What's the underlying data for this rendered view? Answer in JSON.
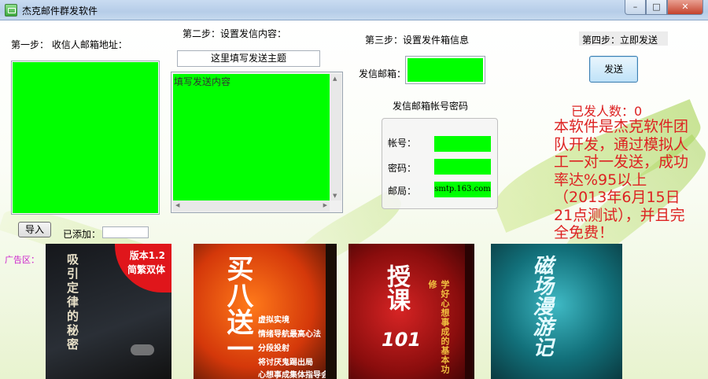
{
  "window": {
    "title": "杰克邮件群发软件",
    "controls": {
      "minimize": "–",
      "maximize": "□",
      "close": "✕"
    }
  },
  "step1": {
    "label": "第一步：  收信人邮箱地址："
  },
  "step2": {
    "label": "第二步：设置发信内容：",
    "subject_value": "这里填写发送主题",
    "content_value": "填写发送内容"
  },
  "step3": {
    "label": "第三步：设置发件箱信息",
    "sender_label": "发信邮箱：",
    "password_group_label": "发信邮箱帐号密码",
    "account_label": "帐号：",
    "password_label": "密码：",
    "server_label": "邮局：",
    "server_value": "smtp.163.com"
  },
  "step4": {
    "label": "第四步：立即发送",
    "send_button": "发送"
  },
  "import": {
    "button_label": "导入",
    "added_label": "已添加：",
    "added_value": ""
  },
  "status": {
    "sent_count": "已发人数：0"
  },
  "promo": {
    "text": "本软件是杰克软件团队开发，通过模拟人工一对一发送，成功率达%95以上（2013年6月15日21点测试），并且完全免费！"
  },
  "ads": {
    "label": "广告区：",
    "books": [
      {
        "title": "吸引定律的秘密",
        "badge_line1": "版本1.2",
        "badge_line2": "简繁双体"
      },
      {
        "title": "买八送一",
        "lines": [
          "虚拟实境",
          "情绪导航最高心法",
          "分段投射",
          "将讨厌鬼踢出局",
          "心想事成集体指导会"
        ]
      },
      {
        "title": "授课",
        "number": "101",
        "side_text": "学好心想事成的基本功修"
      },
      {
        "title": "磁场漫游记"
      }
    ]
  },
  "colors": {
    "field_green": "#00ff00",
    "promo_red": "#dd2222",
    "ad_label_magenta": "#cc22cc"
  }
}
